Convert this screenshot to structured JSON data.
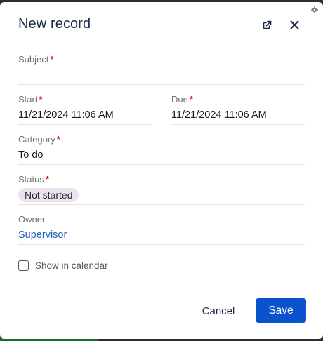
{
  "dialog": {
    "title": "New record",
    "icons": {
      "settings": "gear-icon",
      "open_in_new": "open-in-new-icon",
      "close": "close-icon"
    }
  },
  "fields": {
    "subject": {
      "label": "Subject",
      "required": true,
      "value": ""
    },
    "start": {
      "label": "Start",
      "required": true,
      "value": "11/21/2024 11:06 AM"
    },
    "due": {
      "label": "Due",
      "required": true,
      "value": "11/21/2024 11:06 AM"
    },
    "category": {
      "label": "Category",
      "required": true,
      "value": "To do"
    },
    "status": {
      "label": "Status",
      "required": true,
      "value": "Not started"
    },
    "owner": {
      "label": "Owner",
      "required": false,
      "value": "Supervisor"
    }
  },
  "required_marker": "*",
  "show_in_calendar": {
    "label": "Show in calendar",
    "checked": false
  },
  "buttons": {
    "cancel": "Cancel",
    "save": "Save"
  },
  "colors": {
    "primary": "#0b53ce",
    "required": "#d9261c",
    "status_pill_bg": "#ece3f1",
    "link": "#1f5fbf"
  }
}
